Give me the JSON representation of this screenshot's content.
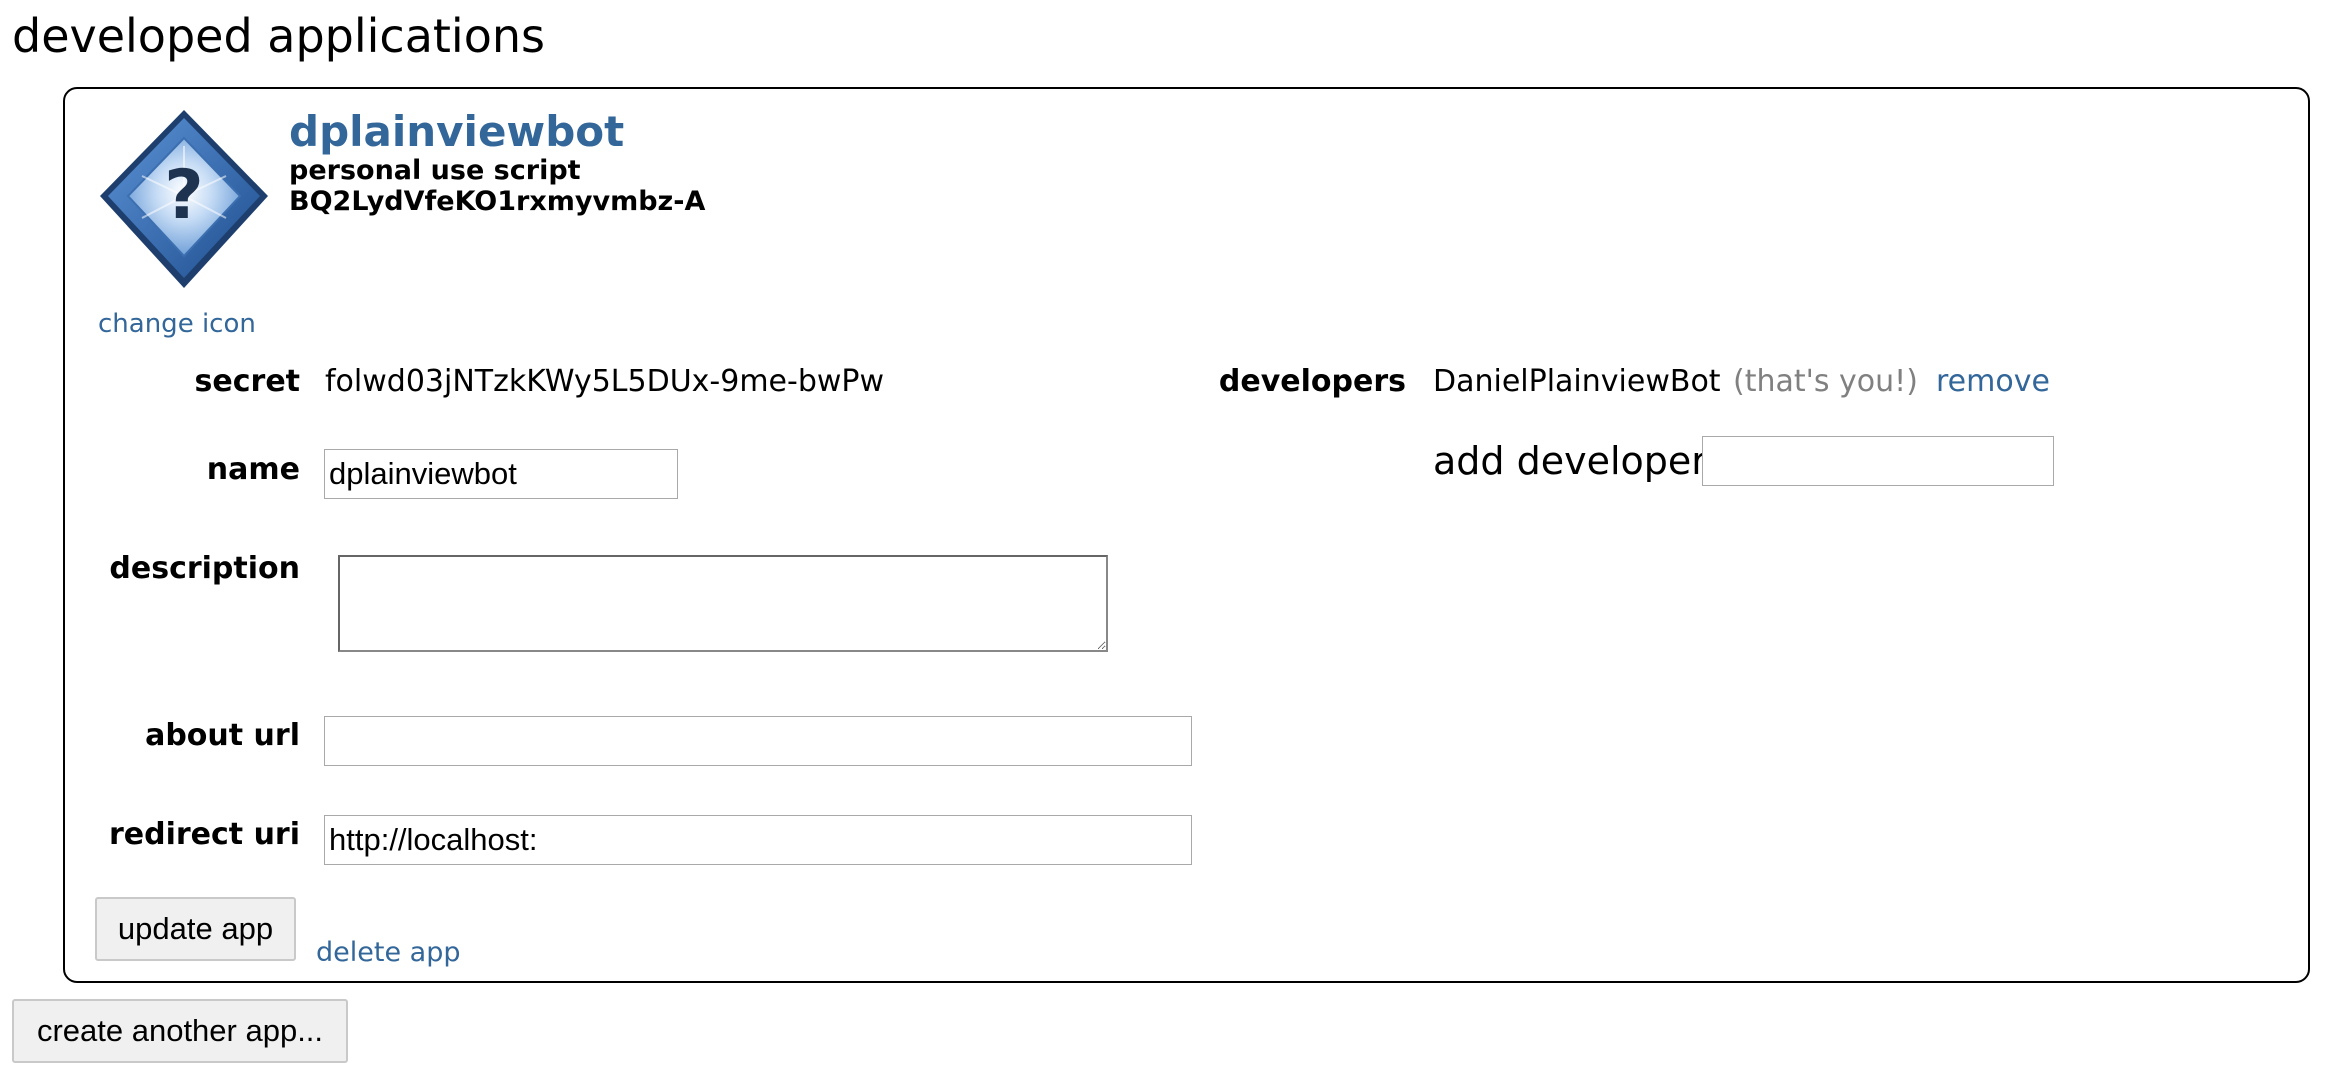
{
  "page": {
    "heading": "developed applications"
  },
  "app": {
    "name": "dplainviewbot",
    "type": "personal use script",
    "client_id": "BQ2LydVfeKO1rxmyvmbz-A",
    "icon": "question-mark-diamond-icon",
    "change_icon_label": "change icon"
  },
  "form": {
    "secret_label": "secret",
    "secret_value": "folwd03jNTzkKWy5L5DUx-9me-bwPw",
    "name_label": "name",
    "name_value": "dplainviewbot",
    "description_label": "description",
    "description_value": "",
    "about_url_label": "about url",
    "about_url_value": "",
    "redirect_uri_label": "redirect uri",
    "redirect_uri_value": "http://localhost:"
  },
  "developers": {
    "label": "developers",
    "name": "DanielPlainviewBot",
    "self_note": "(that's you!)",
    "remove_label": "remove",
    "add_label": "add developer:",
    "add_value": ""
  },
  "actions": {
    "update_label": "update app",
    "delete_label": "delete app",
    "create_label": "create another app..."
  },
  "colors": {
    "link": "#336699",
    "muted": "#808080",
    "icon_blue": "#4a86d1"
  }
}
